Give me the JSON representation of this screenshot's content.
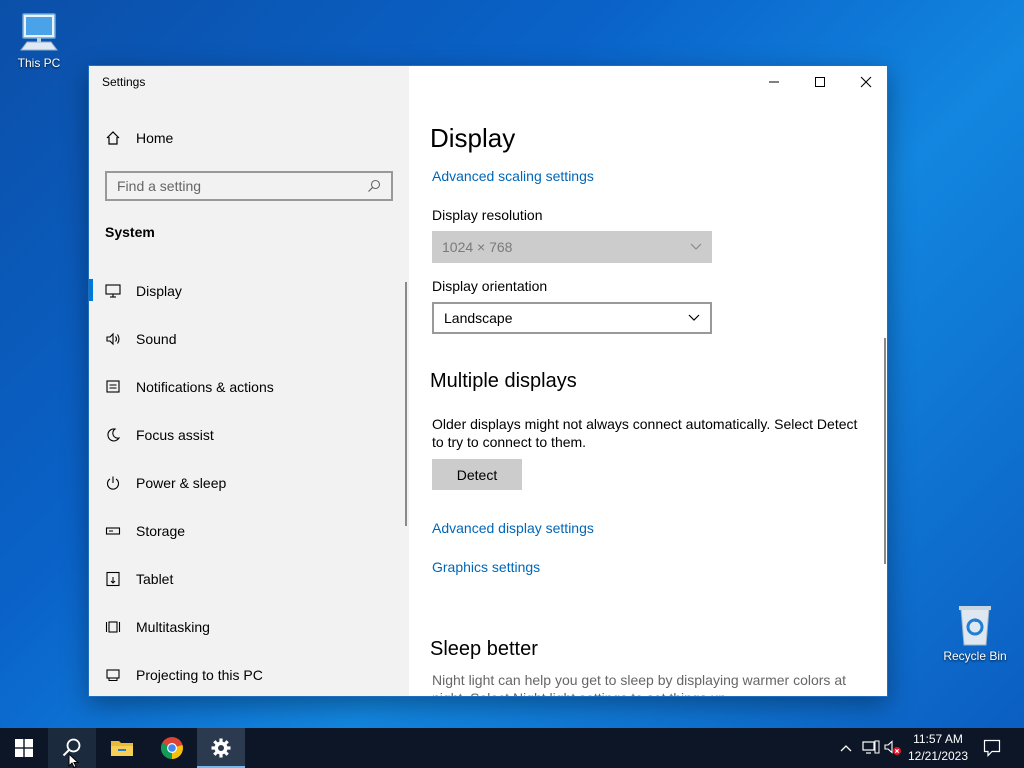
{
  "desktop": {
    "icons": [
      {
        "label": "This PC",
        "icon": "computer-icon"
      },
      {
        "label": "Recycle Bin",
        "icon": "recycle-bin-icon"
      }
    ]
  },
  "window": {
    "title": "Settings",
    "controls": [
      "minimize-icon",
      "maximize-icon",
      "close-icon"
    ]
  },
  "sidebar": {
    "home_label": "Home",
    "search_placeholder": "Find a setting",
    "section_label": "System",
    "items": [
      {
        "label": "Display",
        "icon": "monitor-icon",
        "active": true
      },
      {
        "label": "Sound",
        "icon": "speaker-icon"
      },
      {
        "label": "Notifications & actions",
        "icon": "notification-icon"
      },
      {
        "label": "Focus assist",
        "icon": "moon-icon"
      },
      {
        "label": "Power & sleep",
        "icon": "power-icon"
      },
      {
        "label": "Storage",
        "icon": "storage-icon"
      },
      {
        "label": "Tablet",
        "icon": "tablet-icon"
      },
      {
        "label": "Multitasking",
        "icon": "multitasking-icon"
      },
      {
        "label": "Projecting to this PC",
        "icon": "projecting-icon"
      }
    ]
  },
  "content": {
    "title": "Display",
    "advanced_scaling_link": "Advanced scaling settings",
    "resolution_label": "Display resolution",
    "resolution_value": "1024 × 768",
    "orientation_label": "Display orientation",
    "orientation_value": "Landscape",
    "multiple_displays_heading": "Multiple displays",
    "multiple_displays_text": "Older displays might not always connect automatically. Select Detect to try to connect to them.",
    "detect_button": "Detect",
    "advanced_display_link": "Advanced display settings",
    "graphics_link": "Graphics settings",
    "sleep_heading": "Sleep better",
    "sleep_text": "Night light can help you get to sleep by displaying warmer colors at night. Select Night light settings to set things up."
  },
  "taskbar": {
    "time": "11:57 AM",
    "date": "12/21/2023",
    "pinned": [
      "windows-start-icon",
      "search-icon",
      "file-explorer-icon",
      "chrome-icon",
      "settings-gear-icon"
    ]
  },
  "colors": {
    "accent": "#0078d7",
    "link": "#0067b8",
    "taskbar": "#0c1626"
  }
}
